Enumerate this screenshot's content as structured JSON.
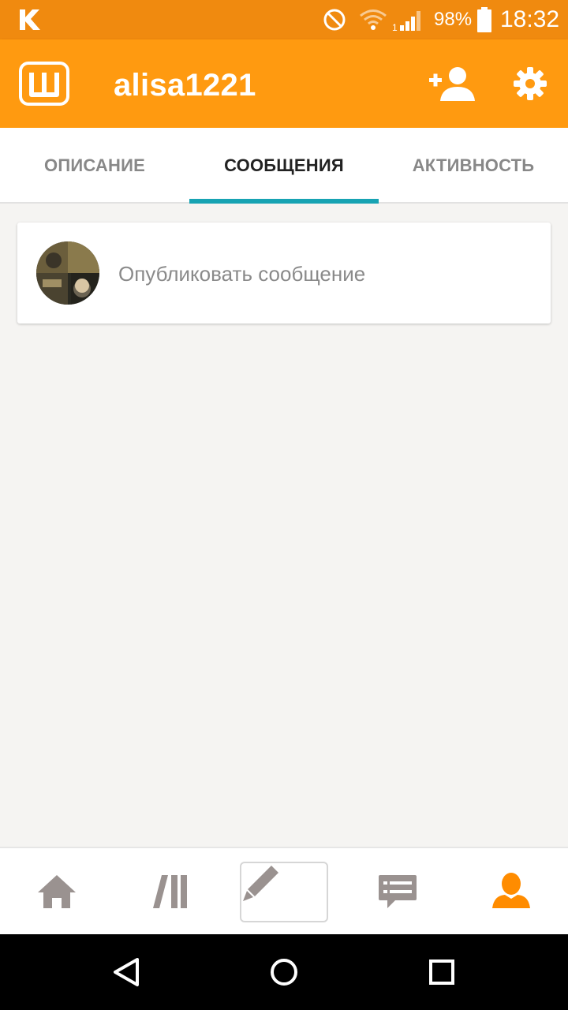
{
  "status_bar": {
    "battery_percent": "98%",
    "time": "18:32",
    "icons": [
      "carrier-k-icon",
      "do-not-disturb-icon",
      "wifi-icon",
      "signal-icon",
      "battery-icon"
    ]
  },
  "app_bar": {
    "logo_icon": "wattpad-logo-icon",
    "title": "alisa1221",
    "actions": [
      "add-user-icon",
      "settings-gear-icon"
    ]
  },
  "tabs": [
    {
      "label": "ОПИСАНИЕ",
      "active": false
    },
    {
      "label": "СООБЩЕНИЯ",
      "active": true
    },
    {
      "label": "АКТИВНОСТЬ",
      "active": false
    }
  ],
  "compose": {
    "prompt": "Опубликовать сообщение"
  },
  "bottom_nav": {
    "items": [
      "home-icon",
      "library-icon",
      "write-pencil-icon",
      "messages-icon",
      "profile-icon"
    ],
    "active": "profile-icon"
  },
  "system_nav": [
    "back-icon",
    "home-circle-icon",
    "recents-icon"
  ],
  "colors": {
    "status_bar": "#f08a0f",
    "app_bar": "#ff9a10",
    "tab_indicator": "#17a3b3",
    "nav_inactive": "#9a9290",
    "nav_active": "#ff8c00"
  }
}
